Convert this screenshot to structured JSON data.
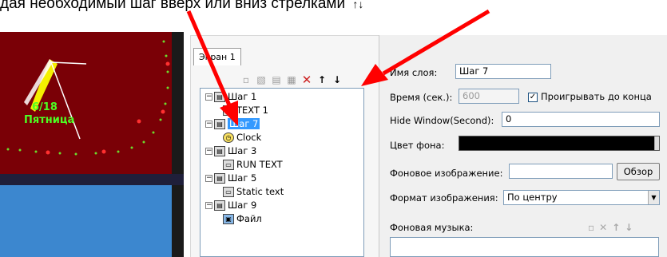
{
  "caption": {
    "text": "дая необходимый шаг вверх или вниз стрелками",
    "glyph": "↑↓"
  },
  "preview": {
    "date": "6/18",
    "day": "Пятница"
  },
  "tabs": [
    {
      "label": "Экран 1"
    }
  ],
  "toolbar": {
    "icons": [
      "new-icon",
      "open-icon",
      "copy-icon",
      "paste-icon",
      "delete-icon",
      "arrow-up-icon",
      "arrow-down-icon"
    ],
    "glyphs": [
      "▫",
      "▧",
      "▤",
      "▦",
      "✕",
      "↑",
      "↓"
    ]
  },
  "tree": [
    {
      "label": "Шаг 1",
      "level": 0
    },
    {
      "label": "TEXT 1",
      "level": 1
    },
    {
      "label": "Шаг 7",
      "level": 0,
      "selected": true
    },
    {
      "label": "Clock",
      "level": 1
    },
    {
      "label": "Шаг 3",
      "level": 0
    },
    {
      "label": "RUN TEXT",
      "level": 1
    },
    {
      "label": "Шаг 5",
      "level": 0
    },
    {
      "label": "Static text",
      "level": 1
    },
    {
      "label": "Шаг 9",
      "level": 0
    },
    {
      "label": "Файл",
      "level": 1
    }
  ],
  "props": {
    "layer_name_label": "Имя слоя:",
    "layer_name_value": "Шаг 7",
    "time_label": "Время (сек.):",
    "time_value": "600",
    "play_to_end_label": "Проигрывать до конца",
    "play_to_end_checked": "✓",
    "hide_window_label": "Hide Window(Second):",
    "hide_window_value": "0",
    "bg_color_label": "Цвет фона:",
    "bg_color_value": "#000000",
    "bg_image_label": "Фоновое изображение:",
    "bg_image_value": "",
    "browse_label": "Обзор",
    "image_format_label": "Формат изображения:",
    "image_format_value": "По центру",
    "bg_music_label": "Фоновая музыка:"
  },
  "colors": {
    "preview_bg": "#7a0006",
    "preview_blue": "#3c87cf",
    "clock_text": "#4cff24",
    "selection": "#3399ff",
    "arrow": "#ff0000"
  }
}
